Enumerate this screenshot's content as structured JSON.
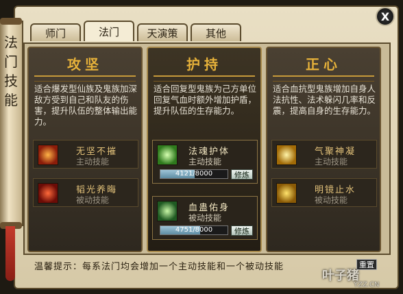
{
  "window": {
    "side_title": "法门技能",
    "close_label": "X"
  },
  "tabs": [
    {
      "label": "师门",
      "active": false
    },
    {
      "label": "法门",
      "active": true
    },
    {
      "label": "天演策",
      "active": false
    },
    {
      "label": "其他",
      "active": false
    }
  ],
  "columns": [
    {
      "title": "攻坚",
      "description": "适合爆发型仙族及鬼族加深敌方受到自己和队友的伤害，提升队伍的整体输出能力。",
      "skills": [
        {
          "name": "无坚不摧",
          "type": "主动技能",
          "icon": "fire-warrior-icon"
        },
        {
          "name": "韬光养晦",
          "type": "被动技能",
          "icon": "red-flame-icon"
        }
      ]
    },
    {
      "title": "护持",
      "description": "适合回复型鬼族为己方单位回复气血时额外增加护盾，提升队伍的生存能力。",
      "skills": [
        {
          "name": "法魂护体",
          "type": "主动技能",
          "icon": "green-spirit-icon",
          "progress": "4121/8000",
          "progress_fraction": 0.515,
          "button": "修炼"
        },
        {
          "name": "血蛊佑身",
          "type": "被动技能",
          "icon": "green-vortex-icon",
          "progress": "4751/8000",
          "progress_fraction": 0.594,
          "button": "修炼"
        }
      ]
    },
    {
      "title": "正心",
      "description": "适合血抗型鬼族增加自身人法抗性、法术躲闪几率和反震，提高自身的生存能力。",
      "skills": [
        {
          "name": "气聚神凝",
          "type": "主动技能",
          "icon": "golden-monk-icon"
        },
        {
          "name": "明镜止水",
          "type": "被动技能",
          "icon": "golden-burst-icon"
        }
      ]
    }
  ],
  "footer": {
    "tip": "温馨提示：每系法门均会增加一个主动技能和一个被动技能",
    "reset_button": "重置"
  },
  "watermark": {
    "brand": "叶子猪",
    "site": "YZZ.CN"
  }
}
